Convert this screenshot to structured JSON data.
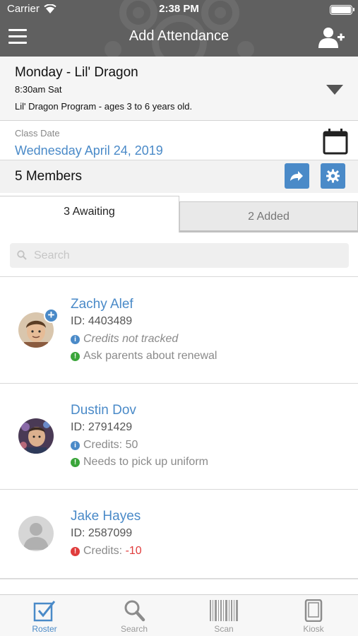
{
  "status_bar": {
    "carrier": "Carrier",
    "time": "2:38 PM"
  },
  "header": {
    "title": "Add Attendance",
    "menu_icon": "hamburger-icon",
    "add_icon": "add-user-icon"
  },
  "class": {
    "name": "Monday - Lil' Dragon",
    "time": "8:30am Sat",
    "description": "Lil' Dragon Program - ages 3 to 6 years old."
  },
  "date": {
    "label": "Class Date",
    "value": "Wednesday April 24, 2019"
  },
  "members": {
    "count_label": "5 Members"
  },
  "tabs": [
    {
      "label": "3 Awaiting",
      "active": true
    },
    {
      "label": "2 Added",
      "active": false
    }
  ],
  "search": {
    "placeholder": "Search",
    "value": ""
  },
  "member_list": [
    {
      "name": "Zachy Alef",
      "id": "ID: 4403489",
      "line1": "Credits not tracked",
      "line2": "Ask parents about renewal"
    },
    {
      "name": "Dustin Dov",
      "id": "ID: 2791429",
      "line1": "Credits: 50",
      "line2": "Needs to pick up uniform"
    },
    {
      "name": "Jake Hayes",
      "id": "ID: 2587099",
      "credits_label": "Credits:",
      "credits_value": "-10"
    }
  ],
  "tabbar": [
    {
      "label": "Roster",
      "icon": "roster-check-icon"
    },
    {
      "label": "Search",
      "icon": "search-icon"
    },
    {
      "label": "Scan",
      "icon": "barcode-icon"
    },
    {
      "label": "Kiosk",
      "icon": "tablet-icon"
    }
  ],
  "colors": {
    "accent": "#4a8ac8",
    "header_bg": "#606060",
    "alert_red": "#e03c3c",
    "note_green": "#3aa53a"
  }
}
